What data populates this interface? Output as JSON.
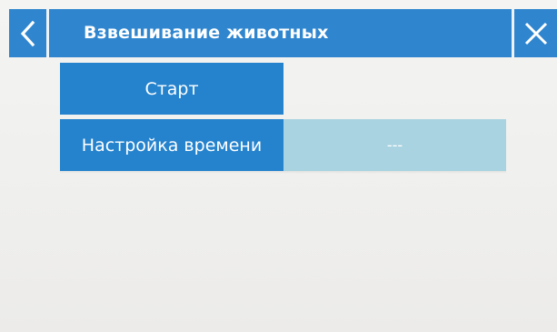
{
  "header": {
    "title": "Взвешивание животных",
    "back_icon": "chevron-left-icon",
    "close_icon": "close-icon",
    "accent_color": "#2f86cf"
  },
  "menu": {
    "start_label": "Старт",
    "time_setting_label": "Настройка времени",
    "time_setting_value": "---"
  },
  "colors": {
    "button_blue": "#2583cd",
    "value_field": "#a9d3e1",
    "background": "#f1f1ef"
  }
}
